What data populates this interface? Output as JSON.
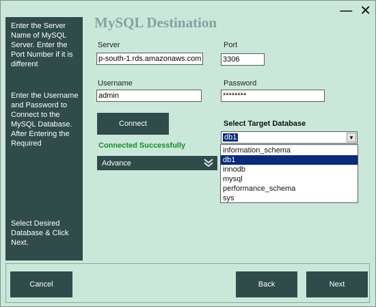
{
  "window": {
    "minimize_glyph": "—",
    "close_glyph": "✕"
  },
  "title": "MySQL Destination",
  "sidebar": {
    "help_1": "Enter the Server Name of MySQL Server. Enter the Port Number if it is different",
    "help_2": "Enter the Username and Password to Connect to the MySQL Database. After Entering the Required",
    "help_3": "Select Desired Database & Click Next."
  },
  "form": {
    "server_label": "Server",
    "server_value": "p-south-1.rds.amazonaws.com",
    "port_label": "Port",
    "port_value": "3306",
    "username_label": "Username",
    "username_value": "admin",
    "password_label": "Password",
    "password_value": "********"
  },
  "connect_label": "Connect",
  "status_text": "Connected Successfully",
  "advance_label": "Advance",
  "target_db": {
    "label": "Select Target Database",
    "selected": "db1",
    "options": [
      "information_schema",
      "db1",
      "innodb",
      "mysql",
      "performance_schema",
      "sys"
    ]
  },
  "footer": {
    "cancel_label": "Cancel",
    "back_label": "Back",
    "next_label": "Next"
  },
  "colors": {
    "background": "#c9e8d9",
    "panel": "#2f4b4a",
    "accent_selected": "#0b2a7a",
    "success": "#1a8a2a"
  },
  "icons": {
    "advance": "double-chevron-down-icon",
    "dropdown": "dropdown-arrow-icon"
  }
}
